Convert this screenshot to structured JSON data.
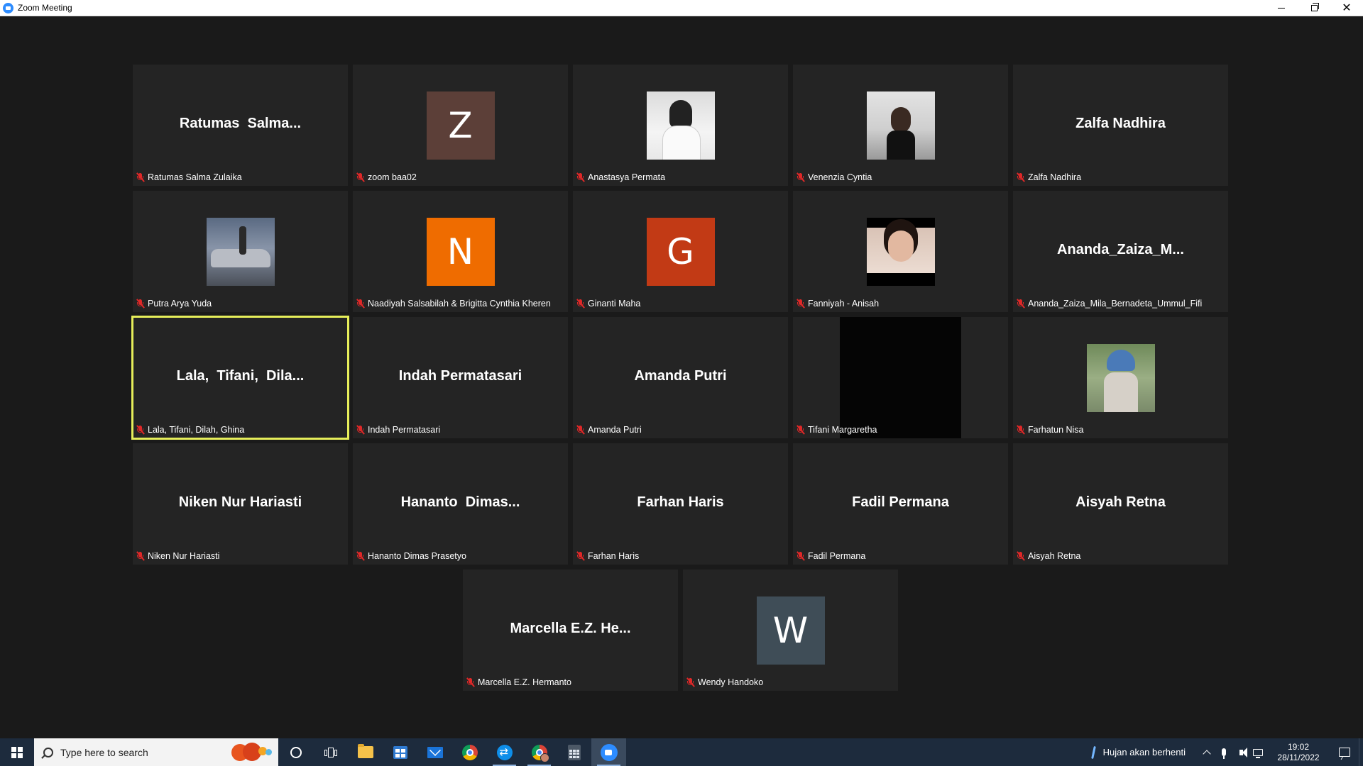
{
  "window": {
    "title": "Zoom Meeting",
    "icon": "zoom-icon",
    "controls": [
      "minimize-icon",
      "restore-icon",
      "close-icon"
    ]
  },
  "participants": [
    {
      "display_name": "Ratumas  Salma...",
      "label": "Ratumas Salma Zulaika",
      "type": "name",
      "muted": true
    },
    {
      "display_name": "",
      "label": "zoom baa02",
      "type": "avatar",
      "initial": "Z",
      "color": "#5c3f38",
      "muted": true
    },
    {
      "display_name": "",
      "label": "Anastasya Permata",
      "type": "photo",
      "photo": "anastasya",
      "muted": true
    },
    {
      "display_name": "",
      "label": "Venenzia Cyntia",
      "type": "photo",
      "photo": "venenzia",
      "muted": true
    },
    {
      "display_name": "Zalfa Nadhira",
      "label": "Zalfa Nadhira",
      "type": "name",
      "muted": true
    },
    {
      "display_name": "",
      "label": "Putra Arya Yuda",
      "type": "photo",
      "photo": "putra",
      "muted": true
    },
    {
      "display_name": "",
      "label": "Naadiyah Salsabilah & Brigitta Cynthia Kheren",
      "type": "avatar",
      "initial": "N",
      "color": "#ef6c00",
      "muted": true
    },
    {
      "display_name": "",
      "label": "Ginanti Maha",
      "type": "avatar",
      "initial": "G",
      "color": "#c23a15",
      "muted": true
    },
    {
      "display_name": "",
      "label": "Fanniyah - Anisah",
      "type": "photo",
      "photo": "fanniyah",
      "muted": true
    },
    {
      "display_name": "Ananda_Zaiza_M...",
      "label": "Ananda_Zaiza_Mila_Bernadeta_Ummul_Fifi",
      "type": "name",
      "muted": true
    },
    {
      "display_name": "Lala,  Tifani,  Dila...",
      "label": "Lala, Tifani, Dilah, Ghina",
      "type": "name",
      "muted": true,
      "active_speaker": true
    },
    {
      "display_name": "Indah Permatasari",
      "label": "Indah Permatasari",
      "type": "name",
      "muted": true
    },
    {
      "display_name": "Amanda Putri",
      "label": "Amanda Putri",
      "type": "name",
      "muted": true
    },
    {
      "display_name": "",
      "label": "Tifani Margaretha",
      "type": "video",
      "muted": true
    },
    {
      "display_name": "",
      "label": "Farhatun Nisa",
      "type": "photo",
      "photo": "farhatun",
      "muted": true
    },
    {
      "display_name": "Niken Nur Hariasti",
      "label": "Niken Nur Hariasti",
      "type": "name",
      "muted": true
    },
    {
      "display_name": "Hananto  Dimas...",
      "label": "Hananto Dimas Prasetyo",
      "type": "name",
      "muted": true
    },
    {
      "display_name": "Farhan Haris",
      "label": "Farhan Haris",
      "type": "name",
      "muted": true
    },
    {
      "display_name": "Fadil Permana",
      "label": "Fadil Permana",
      "type": "name",
      "muted": true
    },
    {
      "display_name": "Aisyah Retna",
      "label": "Aisyah Retna",
      "type": "name",
      "muted": true
    },
    {
      "display_name": "Marcella E.Z. He...",
      "label": "Marcella E.Z. Hermanto",
      "type": "name",
      "muted": true
    },
    {
      "display_name": "",
      "label": "Wendy Handoko",
      "type": "avatar",
      "initial": "W",
      "color": "#3f4d57",
      "muted": true
    }
  ],
  "colors": {
    "background": "#1a1a1a",
    "tile": "#242424",
    "active_speaker_border": "#e6ee5a",
    "muted_icon": "#e02828",
    "taskbar": "#1d2b3d"
  },
  "taskbar": {
    "search_placeholder": "Type here to search",
    "apps": [
      "cortana-icon",
      "task-view-icon",
      "file-explorer-icon",
      "store-icon",
      "mail-icon",
      "chrome-icon",
      "teamviewer-icon",
      "chrome-profile-icon",
      "calculator-icon",
      "zoom-icon"
    ],
    "active_app": "zoom-icon",
    "weather_text": "Hujan akan berhenti",
    "time": "19:02",
    "date": "28/11/2022"
  }
}
